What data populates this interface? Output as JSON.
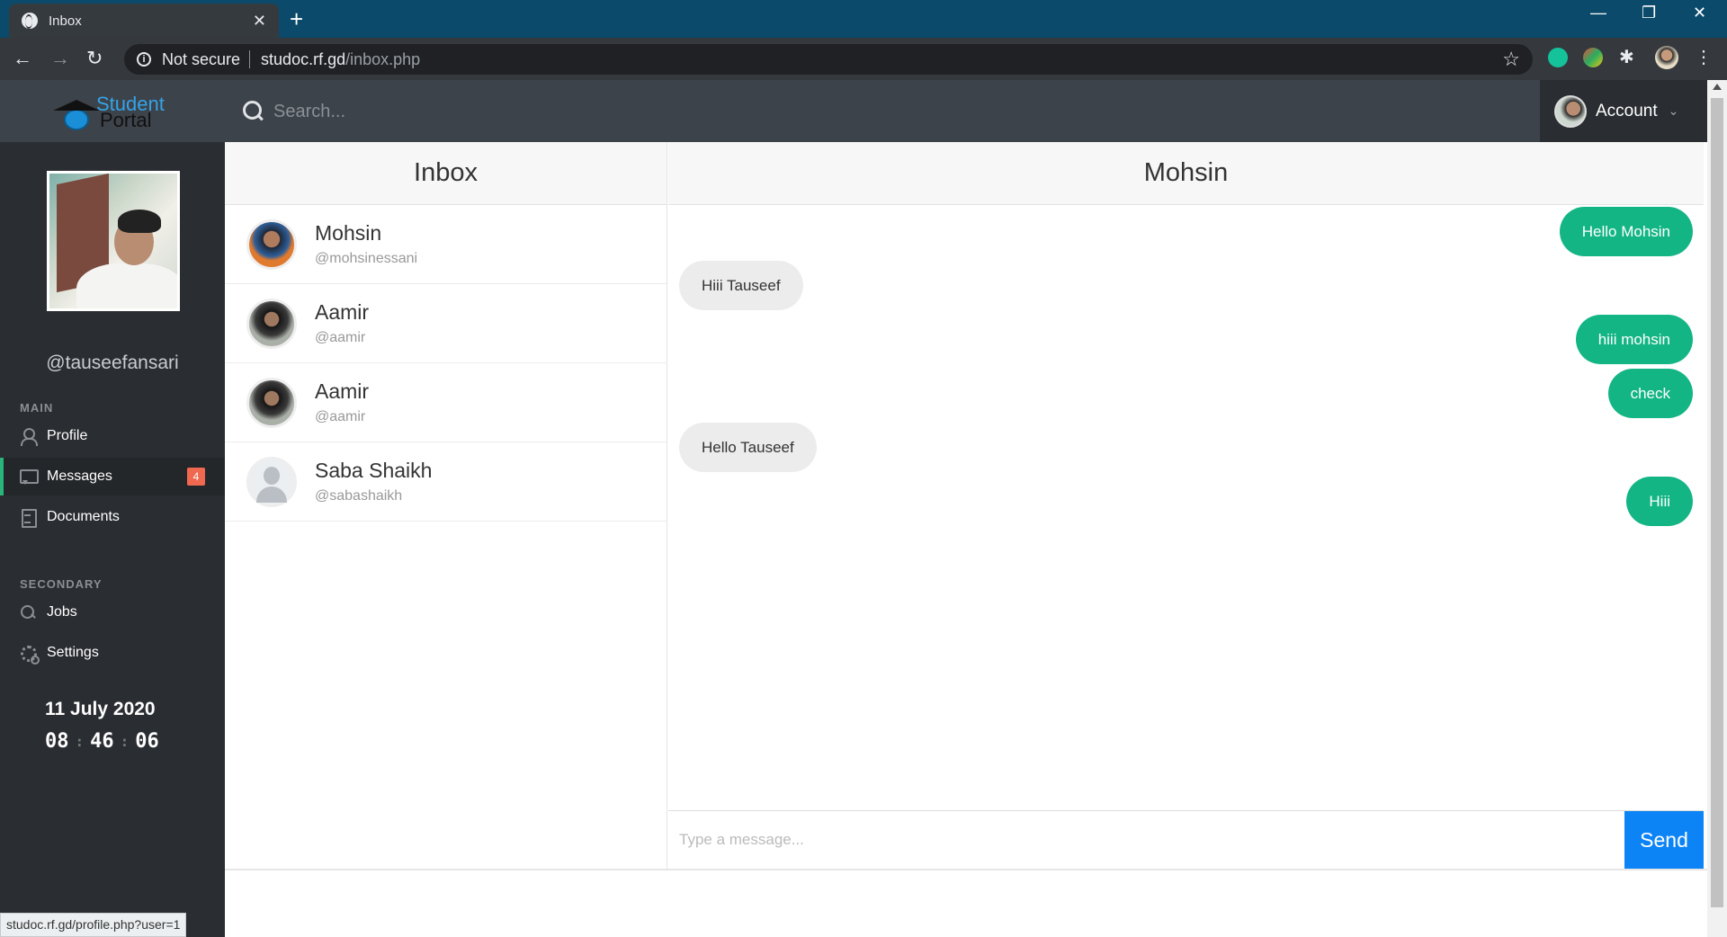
{
  "browser": {
    "tab_title": "Inbox",
    "security": "Not secure",
    "url_host": "studoc.rf.gd",
    "url_path": "/inbox.php",
    "status_url": "studoc.rf.gd/profile.php?user=1"
  },
  "logo": {
    "line1": "Student",
    "line2": "Portal"
  },
  "sidebar": {
    "username": "@tauseefansari",
    "main_label": "MAIN",
    "secondary_label": "SECONDARY",
    "items": [
      {
        "label": "Profile",
        "icon": "user-icon"
      },
      {
        "label": "Messages",
        "icon": "chat-icon",
        "badge": "4"
      },
      {
        "label": "Documents",
        "icon": "document-icon"
      },
      {
        "label": "Jobs",
        "icon": "search-icon"
      },
      {
        "label": "Settings",
        "icon": "gear-icon"
      }
    ],
    "date": "11 July 2020",
    "time": {
      "h": "08",
      "m": "46",
      "s": "06"
    }
  },
  "topbar": {
    "search_placeholder": "Search...",
    "account_label": "Account"
  },
  "inbox": {
    "title": "Inbox",
    "contacts": [
      {
        "name": "Mohsin",
        "handle": "@mohsinessani"
      },
      {
        "name": "Aamir",
        "handle": "@aamir"
      },
      {
        "name": "Aamir",
        "handle": "@aamir"
      },
      {
        "name": "Saba Shaikh",
        "handle": "@sabashaikh"
      }
    ]
  },
  "chat": {
    "title": "Mohsin",
    "messages": [
      {
        "text": "Hello Mohsin",
        "direction": "out"
      },
      {
        "text": "Hiii Tauseef",
        "direction": "in"
      },
      {
        "text": "hiii mohsin",
        "direction": "out"
      },
      {
        "text": "check",
        "direction": "out"
      },
      {
        "text": "Hello Tauseef",
        "direction": "in"
      },
      {
        "text": "Hiii",
        "direction": "out"
      }
    ],
    "input_placeholder": "Type a message...",
    "send_label": "Send"
  },
  "colors": {
    "accent_green": "#13b584",
    "send_blue": "#0d84f5",
    "badge_red": "#f0684f"
  }
}
